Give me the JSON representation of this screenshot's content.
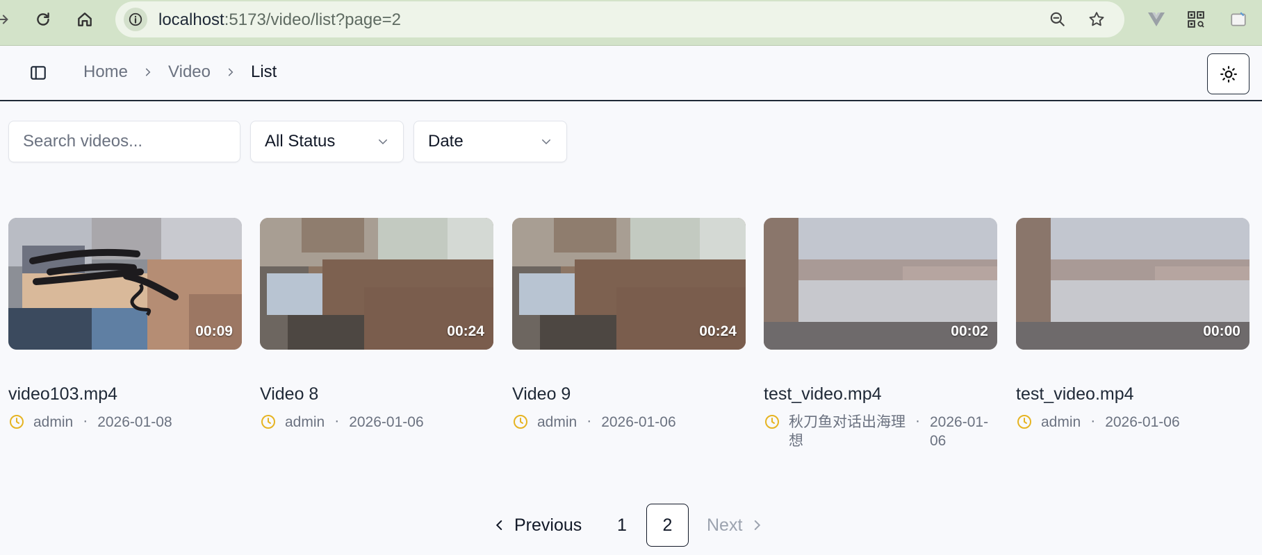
{
  "browser": {
    "url_host": "localhost",
    "url_rest": ":5173/video/list?page=2"
  },
  "header": {
    "breadcrumb": [
      "Home",
      "Video",
      "List"
    ]
  },
  "filters": {
    "search_placeholder": "Search videos...",
    "status_value": "All Status",
    "sort_value": "Date"
  },
  "videos": [
    {
      "title": "video103.mp4",
      "owner": "admin",
      "date": "2026-01-08",
      "duration": "00:09"
    },
    {
      "title": "Video 8",
      "owner": "admin",
      "date": "2026-01-06",
      "duration": "00:24"
    },
    {
      "title": "Video 9",
      "owner": "admin",
      "date": "2026-01-06",
      "duration": "00:24"
    },
    {
      "title": "test_video.mp4",
      "owner": "秋刀鱼对话出海理想",
      "date": "2026-01-06",
      "duration": "00:02"
    },
    {
      "title": "test_video.mp4",
      "owner": "admin",
      "date": "2026-01-06",
      "duration": "00:00"
    }
  ],
  "pagination": {
    "previous_label": "Previous",
    "next_label": "Next",
    "pages": [
      "1",
      "2"
    ],
    "current_page": "2"
  },
  "colors": {
    "accent_clock": "#e6b422",
    "chrome_bg": "#d3e3c9"
  }
}
